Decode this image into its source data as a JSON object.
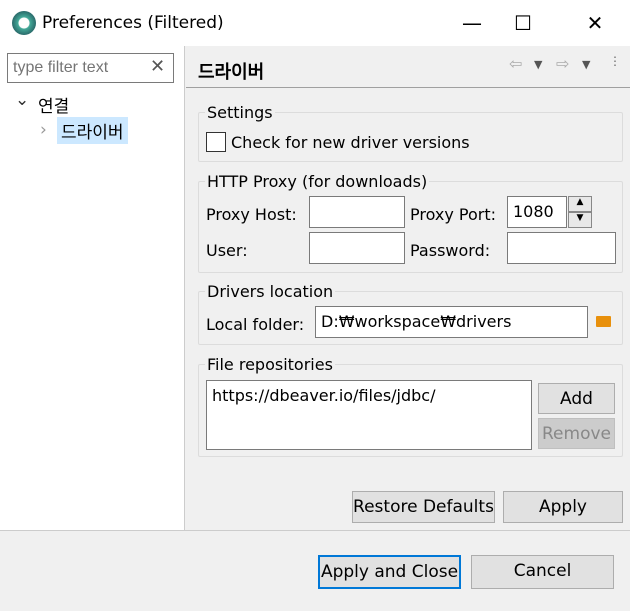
{
  "window": {
    "title": "Preferences (Filtered)",
    "minimize_icon": "minimize-icon",
    "maximize_icon": "maximize-icon",
    "close_icon": "close-icon"
  },
  "sidebar": {
    "filter_placeholder": "type filter text",
    "tree": [
      {
        "label": "연결",
        "expanded": true,
        "children": [
          {
            "label": "드라이버",
            "selected": true
          }
        ]
      }
    ]
  },
  "page": {
    "title": "드라이버",
    "settings": {
      "label": "Settings",
      "check_new_versions": "Check for new driver versions",
      "checked": false
    },
    "proxy": {
      "label": "HTTP Proxy (for downloads)",
      "host_label": "Proxy Host:",
      "host_value": "",
      "port_label": "Proxy Port:",
      "port_value": "1080",
      "user_label": "User:",
      "user_value": "",
      "password_label": "Password:",
      "password_value": ""
    },
    "location": {
      "label": "Drivers location",
      "folder_label": "Local folder:",
      "folder_value": "D:₩workspace₩drivers"
    },
    "repos": {
      "label": "File repositories",
      "items": [
        "https://dbeaver.io/files/jdbc/"
      ],
      "add": "Add",
      "remove": "Remove"
    },
    "restore_defaults": "Restore Defaults",
    "apply": "Apply"
  },
  "footer": {
    "apply_close": "Apply and Close",
    "cancel": "Cancel"
  }
}
